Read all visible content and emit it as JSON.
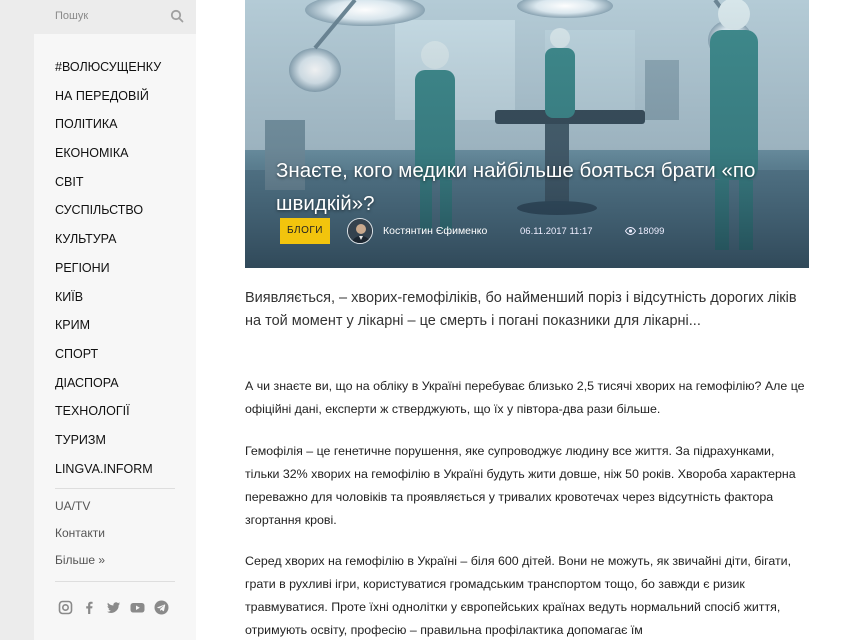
{
  "search": {
    "placeholder": "Пошук"
  },
  "nav": [
    "#ВОЛЮСУЩЕНКУ",
    "НА ПЕРЕДОВІЙ",
    "ПОЛІТИКА",
    "ЕКОНОМІКА",
    "СВІТ",
    "СУСПІЛЬСТВО",
    "КУЛЬТУРА",
    "РЕГІОНИ",
    "КИЇВ",
    "КРИМ",
    "СПОРТ",
    "ДІАСПОРА",
    "ТЕХНОЛОГІЇ",
    "ТУРИЗМ",
    "LINGVA.INFORM"
  ],
  "secondary": [
    "UA/TV",
    "Контакти",
    "Більше »"
  ],
  "social_icons": [
    "instagram-icon",
    "facebook-icon",
    "twitter-icon",
    "youtube-icon",
    "telegram-icon"
  ],
  "article": {
    "title": "Знаєте, кого медики найбільше бояться брати «по швидкій»?",
    "category": "БЛОГИ",
    "author": "Костянтин Єфименко",
    "date": "06.11.2017 11:17",
    "views": "18099",
    "lead": "Виявляється, – хворих-гемофіліків, бо найменший поріз і відсутність дорогих ліків на той момент у лікарні – це смерть і погані показники для лікарні...",
    "paragraphs": [
      "А чи знаєте ви, що на обліку в Україні перебуває близько 2,5 тисячі хворих на гемофілію? Але це офіційні дані, експерти ж стверджують, що їх у півтора-два рази більше.",
      "Гемофілія – це генетичне порушення, яке супроводжує людину все життя. За підрахунками, тільки 32% хворих на гемофілію в Україні будуть жити довше, ніж 50 років. Хвороба характерна переважно для чоловіків та проявляється у тривалих кровотечах через відсутність фактора згортання крові.",
      "Серед хворих на гемофілію в Україні – біля 600 дітей. Вони не можуть, як звичайні діти, бігати, грати в рухливі ігри, користуватися громадським транспортом тощо, бо завжди є ризик травмуватися. Проте їхні однолітки у європейських країнах ведуть нормальний спосіб життя, отримують освіту, професію – правильна профілактика допомагає їм"
    ]
  },
  "colors": {
    "badge": "#f2c40d",
    "sidebar_bg": "#f7f7f7",
    "search_bg": "#ececec"
  }
}
